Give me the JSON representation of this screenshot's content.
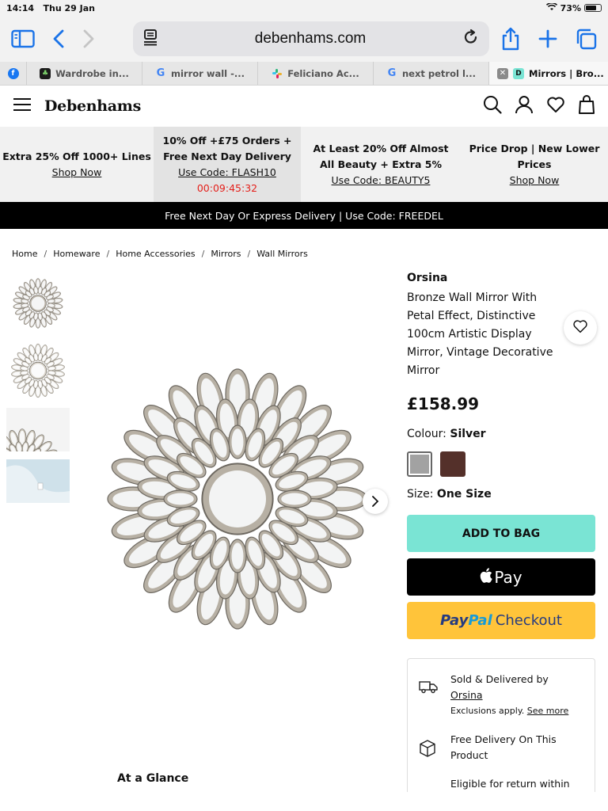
{
  "status": {
    "time": "14:14",
    "date": "Thu 29 Jan",
    "battery": "73%",
    "battery_level": 0.73
  },
  "browser": {
    "url": "debenhams.com"
  },
  "tabs": [
    {
      "label": "",
      "icon": "facebook-icon",
      "color": "#1877f2"
    },
    {
      "label": "Wardrobe in...",
      "icon": "tree-icon",
      "color": "#2e7d32"
    },
    {
      "label": "mirror wall -...",
      "icon": "google-icon",
      "color": "#4285f4"
    },
    {
      "label": "Feliciano Ac...",
      "icon": "slack-icon",
      "color": "#e01e5a"
    },
    {
      "label": "next petrol l...",
      "icon": "google-icon",
      "color": "#4285f4"
    },
    {
      "label": "Mirrors | Bro...",
      "icon": "debenhams-icon",
      "color": "#1fb5a5",
      "active": true
    }
  ],
  "site": {
    "logo": "Debenhams"
  },
  "promos": [
    {
      "line1": "Extra 25% Off 1000+ Lines",
      "link": "Shop Now"
    },
    {
      "line1": "10% Off +£75 Orders +",
      "line2": "Free Next Day Delivery",
      "code": "Use Code: FLASH10",
      "timer": "00:09:45:32"
    },
    {
      "line1": "At Least 20% Off Almost",
      "line2": "All Beauty + Extra 5%",
      "code": "Use Code: BEAUTY5"
    },
    {
      "line1": "Price Drop | New Lower",
      "line2": "Prices",
      "link": "Shop Now"
    }
  ],
  "delivery_banner": "Free Next Day Or Express Delivery | Use Code: FREEDEL",
  "breadcrumbs": [
    "Home",
    "Homeware",
    "Home Accessories",
    "Mirrors",
    "Wall Mirrors"
  ],
  "product": {
    "brand": "Orsina",
    "title": "Bronze Wall Mirror With Petal Effect, Distinctive 100cm Artistic Display Mirror, Vintage Decorative Mirror",
    "price": "£158.99",
    "colour_label": "Colour:",
    "colour_value": "Silver",
    "swatches": [
      "#a2a2a2",
      "#54302a"
    ],
    "size_label": "Size:",
    "size_value": "One Size",
    "add_to_bag": "ADD TO BAG",
    "apple_pay": "Pay",
    "paypal_1": "Pay",
    "paypal_2": "Pal",
    "paypal_checkout": "Checkout",
    "at_a_glance": "At a Glance"
  },
  "seller": {
    "sold_by": "Sold & Delivered by",
    "seller_name": "Orsina",
    "exclusions": "Exclusions apply.",
    "see_more": "See more",
    "free_delivery_1": "Free Delivery On This",
    "free_delivery_2": "Product",
    "returns": "Eligible for return within"
  }
}
